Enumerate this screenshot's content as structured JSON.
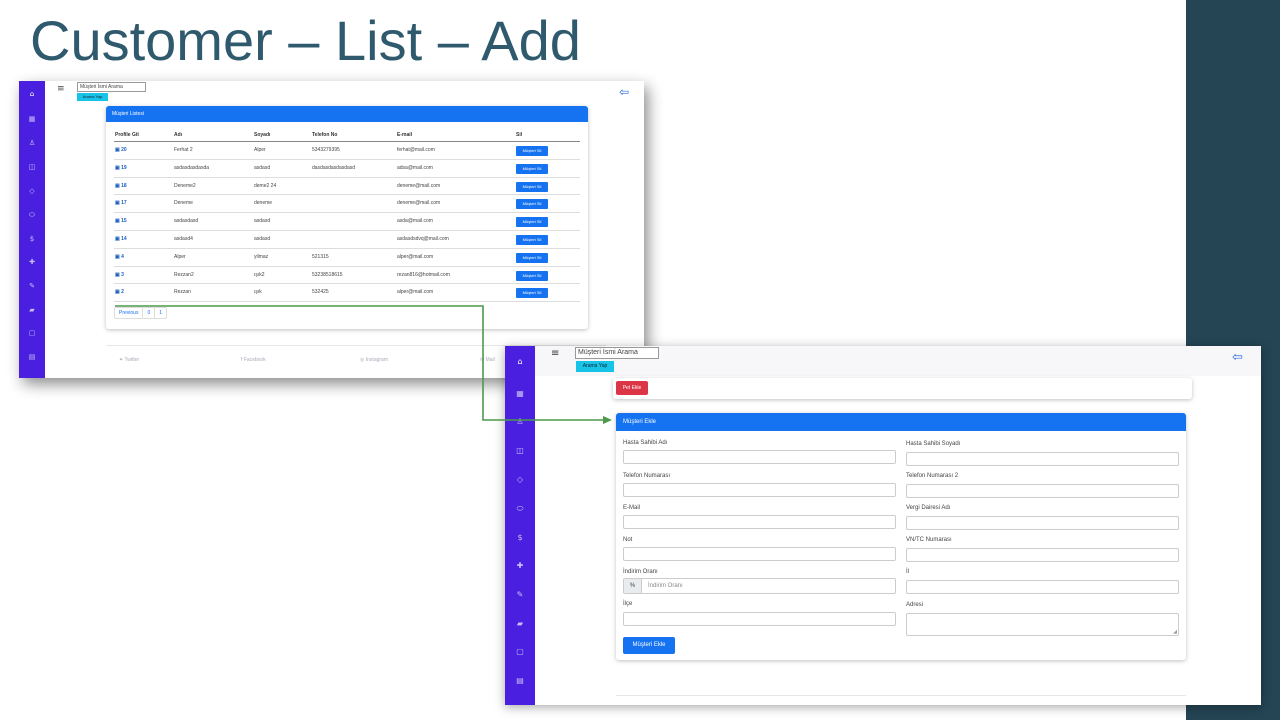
{
  "slide": {
    "title": "Customer – List – Add",
    "colors": {
      "title": "#2f5a6e",
      "band": "#254554",
      "sidebar": "#4a1fe0",
      "primary": "#1572f0",
      "danger": "#dc3545",
      "info": "#17c3e6",
      "arrow": "#4a9a4a"
    }
  },
  "list_screen": {
    "search_placeholder": "Müşteri İsmi Arama",
    "search_button": "Arama Yap",
    "card_title": "Müşteri Listesi",
    "columns": [
      "Profile Git",
      "Adı",
      "Soyadı",
      "Telefon No",
      "E-mail",
      "Sil"
    ],
    "rows": [
      {
        "id": "20",
        "name": "Ferhat 2",
        "surname": "Alper",
        "phone": "5343279395",
        "email": "ferhat@mail.com",
        "action": "Müşteri Sil"
      },
      {
        "id": "19",
        "name": "asdasdasdasda",
        "surname": "asdasd",
        "phone": "dasdasdasdasdasd",
        "email": "adsa@mail.com",
        "action": "Müşteri Sil"
      },
      {
        "id": "18",
        "name": "Deneme2",
        "surname": "deme2 24",
        "phone": "",
        "email": "deneme@mail.com",
        "action": "Müşteri Sil"
      },
      {
        "id": "17",
        "name": "Deneme",
        "surname": "deneme",
        "phone": "",
        "email": "deneme@mail.com",
        "action": "Müşteri Sil"
      },
      {
        "id": "15",
        "name": "asdasdasd",
        "surname": "asdasd",
        "phone": "",
        "email": "asda@mail.com",
        "action": "Müşteri Sil"
      },
      {
        "id": "14",
        "name": "asdasd4",
        "surname": "asdasd",
        "phone": "",
        "email": "asdasdsdvq@mail.com",
        "action": "Müşteri Sil"
      },
      {
        "id": "4",
        "name": "Alper",
        "surname": "yilmaz",
        "phone": "521315",
        "email": "alper@mail.com",
        "action": "Müşteri Sil"
      },
      {
        "id": "3",
        "name": "Rezzan2",
        "surname": "ışık2",
        "phone": "53238518615",
        "email": "rezan816@hotmail.com",
        "action": "Müşteri Sil"
      },
      {
        "id": "2",
        "name": "Rezzan",
        "surname": "ışık",
        "phone": "532425",
        "email": "alper@mail.com",
        "action": "Müşteri Sil"
      }
    ],
    "pagination": [
      "Previous",
      "0",
      "1"
    ],
    "footer": [
      "Twitter",
      "Facebook",
      "Instagram",
      "Mail"
    ]
  },
  "add_screen": {
    "search_placeholder": "Müşteri İsmi Arama",
    "search_button": "Arama Yap",
    "pet_button": "Pet Ekle",
    "card_title": "Müşteri Ekle",
    "labels": {
      "owner_name": "Hasta Sahibi Adı",
      "owner_surname": "Hasta Sahibi Soyadı",
      "phone": "Telefon Numarası",
      "phone2": "Telefon Numarası 2",
      "email": "E-Mail",
      "tax_office": "Vergi Dairesi Adı",
      "note": "Not",
      "tax_id": "VN/TC Numarası",
      "discount": "İndirim Oranı",
      "city": "İl",
      "district": "İlçe",
      "address": "Adresi"
    },
    "discount_prefix": "%",
    "discount_placeholder": "İndirim Oranı",
    "submit_button": "Müşteri Ekle"
  }
}
